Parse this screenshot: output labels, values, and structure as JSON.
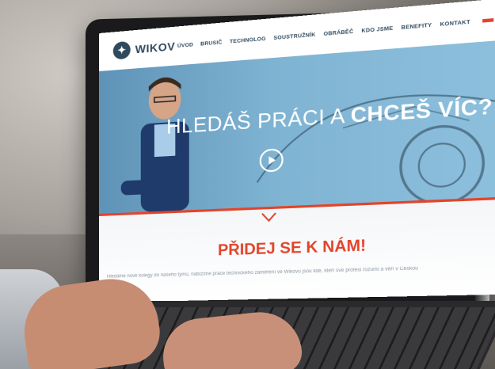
{
  "site": {
    "logo_text": "WIKOV",
    "nav": [
      "ÚVOD",
      "BRUSIČ",
      "TECHNOLOG",
      "SOUSTRUŽNÍK",
      "OBRÁBĚČ",
      "KDO JSME",
      "BENEFITY",
      "KONTAKT"
    ],
    "headline_regular": "HLEDÁŠ PRÁCI A ",
    "headline_bold": "CHCEŠ VÍC?",
    "join": "PŘIDEJ SE K NÁM!",
    "body_text": "Hledáme nové kolegy do našeho týmu, nabízíme práce technického zaměření ve Wikovu jsou lidé, kteří své profesi rozumí a věří v Českou"
  },
  "colors": {
    "accent": "#e2442b",
    "brand": "#2f4a5c",
    "hero": "#7fb3d2"
  },
  "icons": {
    "play": "play-icon",
    "chevron": "chevron-down-icon",
    "logo": "wikov-logo-icon"
  }
}
